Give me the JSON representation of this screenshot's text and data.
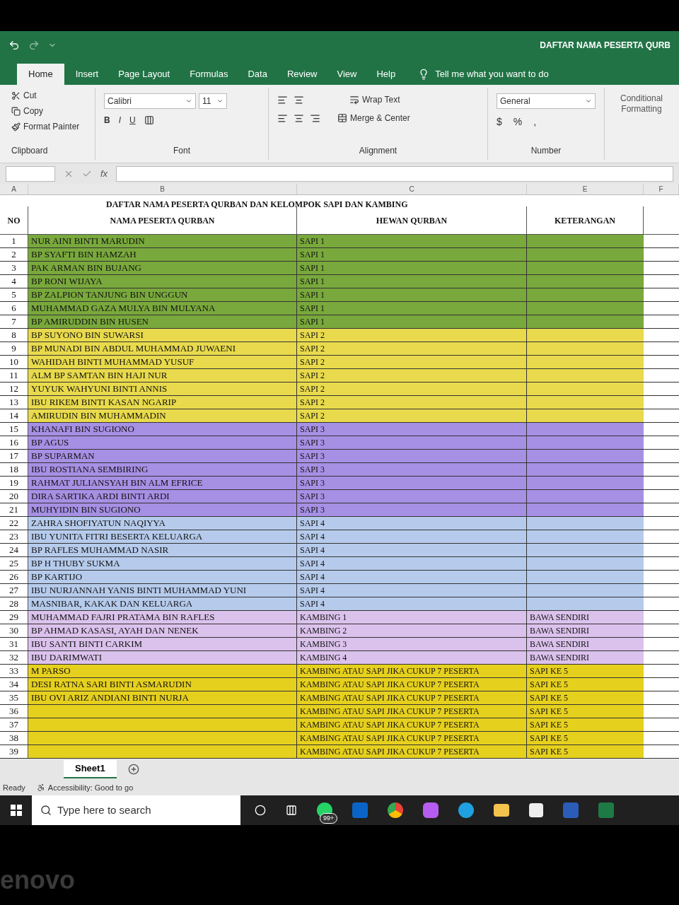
{
  "title_bar": {
    "title": "DAFTAR NAMA PESERTA QURB"
  },
  "ribbon_tabs": [
    {
      "label": "Home",
      "selected": true
    },
    {
      "label": "Insert",
      "selected": false
    },
    {
      "label": "Page Layout",
      "selected": false
    },
    {
      "label": "Formulas",
      "selected": false
    },
    {
      "label": "Data",
      "selected": false
    },
    {
      "label": "Review",
      "selected": false
    },
    {
      "label": "View",
      "selected": false
    },
    {
      "label": "Help",
      "selected": false
    }
  ],
  "tell_me": "Tell me what you want to do",
  "clipboard": {
    "cut": "Cut",
    "copy": "Copy",
    "format_painter": "Format Painter",
    "label": "Clipboard"
  },
  "font": {
    "name": "Calibri",
    "size": "11",
    "bold": "B",
    "italic": "I",
    "underline": "U",
    "label": "Font"
  },
  "alignment": {
    "wrap": "Wrap Text",
    "merge": "Merge & Center",
    "label": "Alignment"
  },
  "number": {
    "format": "General",
    "currency": "$",
    "percent": "%",
    "comma": ",",
    "label": "Number"
  },
  "styles": {
    "conditional": "Conditional Formatting"
  },
  "formula_bar": {
    "fx": "fx"
  },
  "columns": [
    "A",
    "B",
    "C",
    "E",
    "F"
  ],
  "sheet": {
    "title": "DAFTAR NAMA PESERTA QURBAN DAN KELOMPOK SAPI DAN KAMBING",
    "headers": [
      "NO",
      "NAMA PESERTA QURBAN",
      "HEWAN QURBAN",
      "KETERANGAN"
    ],
    "rows": [
      {
        "no": "1",
        "name": "NUR AINI BINTI MARUDIN",
        "hewan": "SAPI 1",
        "color": "#79a83c"
      },
      {
        "no": "2",
        "name": "BP SYAFTI BIN HAMZAH",
        "hewan": "SAPI 1",
        "color": "#79a83c"
      },
      {
        "no": "3",
        "name": "PAK ARMAN BIN BUJANG",
        "hewan": "SAPI 1",
        "color": "#79a83c"
      },
      {
        "no": "4",
        "name": "BP RONI WIJAYA",
        "hewan": "SAPI 1",
        "color": "#79a83c"
      },
      {
        "no": "5",
        "name": "BP ZALPION TANJUNG BIN UNGGUN",
        "hewan": "SAPI 1",
        "color": "#79a83c"
      },
      {
        "no": "6",
        "name": "MUHAMMAD GAZA MULYA  BIN MULYANA",
        "hewan": "SAPI 1",
        "color": "#79a83c"
      },
      {
        "no": "7",
        "name": "BP AMIRUDDIN BIN HUSEN",
        "hewan": "SAPI 1",
        "color": "#79a83c"
      },
      {
        "no": "8",
        "name": "BP SUYONO BIN SUWARSI",
        "hewan": "SAPI 2",
        "color": "#e8da4c"
      },
      {
        "no": "9",
        "name": "BP MUNADI BIN ABDUL MUHAMMAD JUWAENI",
        "hewan": "SAPI 2",
        "color": "#e8da4c"
      },
      {
        "no": "10",
        "name": "WAHIDAH BINTI MUHAMMAD YUSUF",
        "hewan": "SAPI 2",
        "color": "#e8da4c"
      },
      {
        "no": "11",
        "name": "ALM BP SAMTAN BIN HAJI NUR",
        "hewan": "SAPI 2",
        "color": "#e8da4c"
      },
      {
        "no": "12",
        "name": "YUYUK WAHYUNI BINTI ANNIS",
        "hewan": "SAPI 2",
        "color": "#e8da4c"
      },
      {
        "no": "13",
        "name": "IBU RIKEM BINTI KASAN NGARIP",
        "hewan": "SAPI 2",
        "color": "#e8da4c"
      },
      {
        "no": "14",
        "name": "AMIRUDIN BIN MUHAMMADIN",
        "hewan": "SAPI 2",
        "color": "#e8da4c"
      },
      {
        "no": "15",
        "name": "KHANAFI BIN SUGIONO",
        "hewan": "SAPI 3",
        "color": "#a690e4"
      },
      {
        "no": "16",
        "name": "BP AGUS",
        "hewan": "SAPI 3",
        "color": "#a690e4"
      },
      {
        "no": "17",
        "name": "BP SUPARMAN",
        "hewan": "SAPI 3",
        "color": "#a690e4"
      },
      {
        "no": "18",
        "name": "IBU ROSTIANA SEMBIRING",
        "hewan": "SAPI 3",
        "color": "#a690e4"
      },
      {
        "no": "19",
        "name": "RAHMAT  JULIANSYAH BIN ALM EFRICE",
        "hewan": "SAPI 3",
        "color": "#a690e4"
      },
      {
        "no": "20",
        "name": "DIRA SARTIKA ARDI BINTI ARDI",
        "hewan": "SAPI 3",
        "color": "#a690e4"
      },
      {
        "no": "21",
        "name": "MUHYIDIN BIN SUGIONO",
        "hewan": "SAPI 3",
        "color": "#a690e4"
      },
      {
        "no": "22",
        "name": "ZAHRA SHOFIYATUN NAQIYYA",
        "hewan": "SAPI 4",
        "color": "#b6cbec"
      },
      {
        "no": "23",
        "name": "IBU YUNITA FITRI BESERTA KELUARGA",
        "hewan": "SAPI 4",
        "color": "#b6cbec"
      },
      {
        "no": "24",
        "name": "BP RAFLES MUHAMMAD NASIR",
        "hewan": "SAPI 4",
        "color": "#b6cbec"
      },
      {
        "no": "25",
        "name": "BP H THUBY SUKMA",
        "hewan": "SAPI 4",
        "color": "#b6cbec"
      },
      {
        "no": "26",
        "name": "BP KARTIJO",
        "hewan": "SAPI 4",
        "color": "#b6cbec"
      },
      {
        "no": "27",
        "name": "IBU NURJANNAH YANIS BINTI MUHAMMAD YUNI",
        "hewan": "SAPI 4",
        "color": "#b6cbec"
      },
      {
        "no": "28",
        "name": "MASNIBAR, KAKAK DAN KELUARGA",
        "hewan": "SAPI 4",
        "color": "#b6cbec"
      },
      {
        "no": "29",
        "name": "MUHAMMAD FAJRI PRATAMA BIN RAFLES",
        "hewan": "KAMBING 1",
        "keterangan": "BAWA SENDIRI",
        "color": "#dbc2ec"
      },
      {
        "no": "30",
        "name": "BP AHMAD KASASI, AYAH DAN NENEK",
        "hewan": "KAMBING 2",
        "keterangan": "BAWA SENDIRI",
        "color": "#dbc2ec"
      },
      {
        "no": "31",
        "name": "IBU SANTI BINTI CARKIM",
        "hewan": "KAMBING 3",
        "keterangan": "BAWA SENDIRI",
        "color": "#dbc2ec"
      },
      {
        "no": "32",
        "name": "IBU DARIMWATI",
        "hewan": "KAMBING 4",
        "keterangan": "BAWA SENDIRI",
        "color": "#dbc2ec"
      },
      {
        "no": "33",
        "name": "M PARSO",
        "hewan": "KAMBING ATAU SAPI JIKA CUKUP 7 PESERTA",
        "keterangan": "SAPI KE 5",
        "color": "#e6d01e"
      },
      {
        "no": "34",
        "name": "DESI RATNA SARI BINTI ASMARUDIN",
        "hewan": "KAMBING ATAU SAPI JIKA CUKUP 7 PESERTA",
        "keterangan": "SAPI KE 5",
        "color": "#e6d01e"
      },
      {
        "no": "35",
        "name": "IBU OVI ARIZ ANDIANI BINTI NURJA",
        "hewan": "KAMBING ATAU SAPI JIKA CUKUP 7 PESERTA",
        "keterangan": "SAPI KE 5",
        "color": "#e6d01e"
      },
      {
        "no": "36",
        "hewan": "KAMBING ATAU SAPI JIKA CUKUP 7 PESERTA",
        "keterangan": "SAPI KE 5",
        "color": "#e6d01e"
      },
      {
        "no": "37",
        "hewan": "KAMBING ATAU SAPI JIKA CUKUP 7 PESERTA",
        "keterangan": "SAPI KE 5",
        "color": "#e6d01e"
      },
      {
        "no": "38",
        "hewan": "KAMBING ATAU SAPI JIKA CUKUP 7 PESERTA",
        "keterangan": "SAPI KE 5",
        "color": "#e6d01e"
      },
      {
        "no": "39",
        "hewan": "KAMBING ATAU SAPI JIKA CUKUP 7 PESERTA",
        "keterangan": "SAPI KE 5",
        "color": "#e6d01e"
      }
    ]
  },
  "sheet_tabs": [
    {
      "label": "Sheet1",
      "selected": true
    }
  ],
  "status_bar": {
    "ready": "Ready",
    "accessibility": "Accessibility: Good to go"
  },
  "taskbar": {
    "search_placeholder": "Type here to search",
    "badge": "99+"
  },
  "bezel": {
    "logo": "enovo"
  }
}
